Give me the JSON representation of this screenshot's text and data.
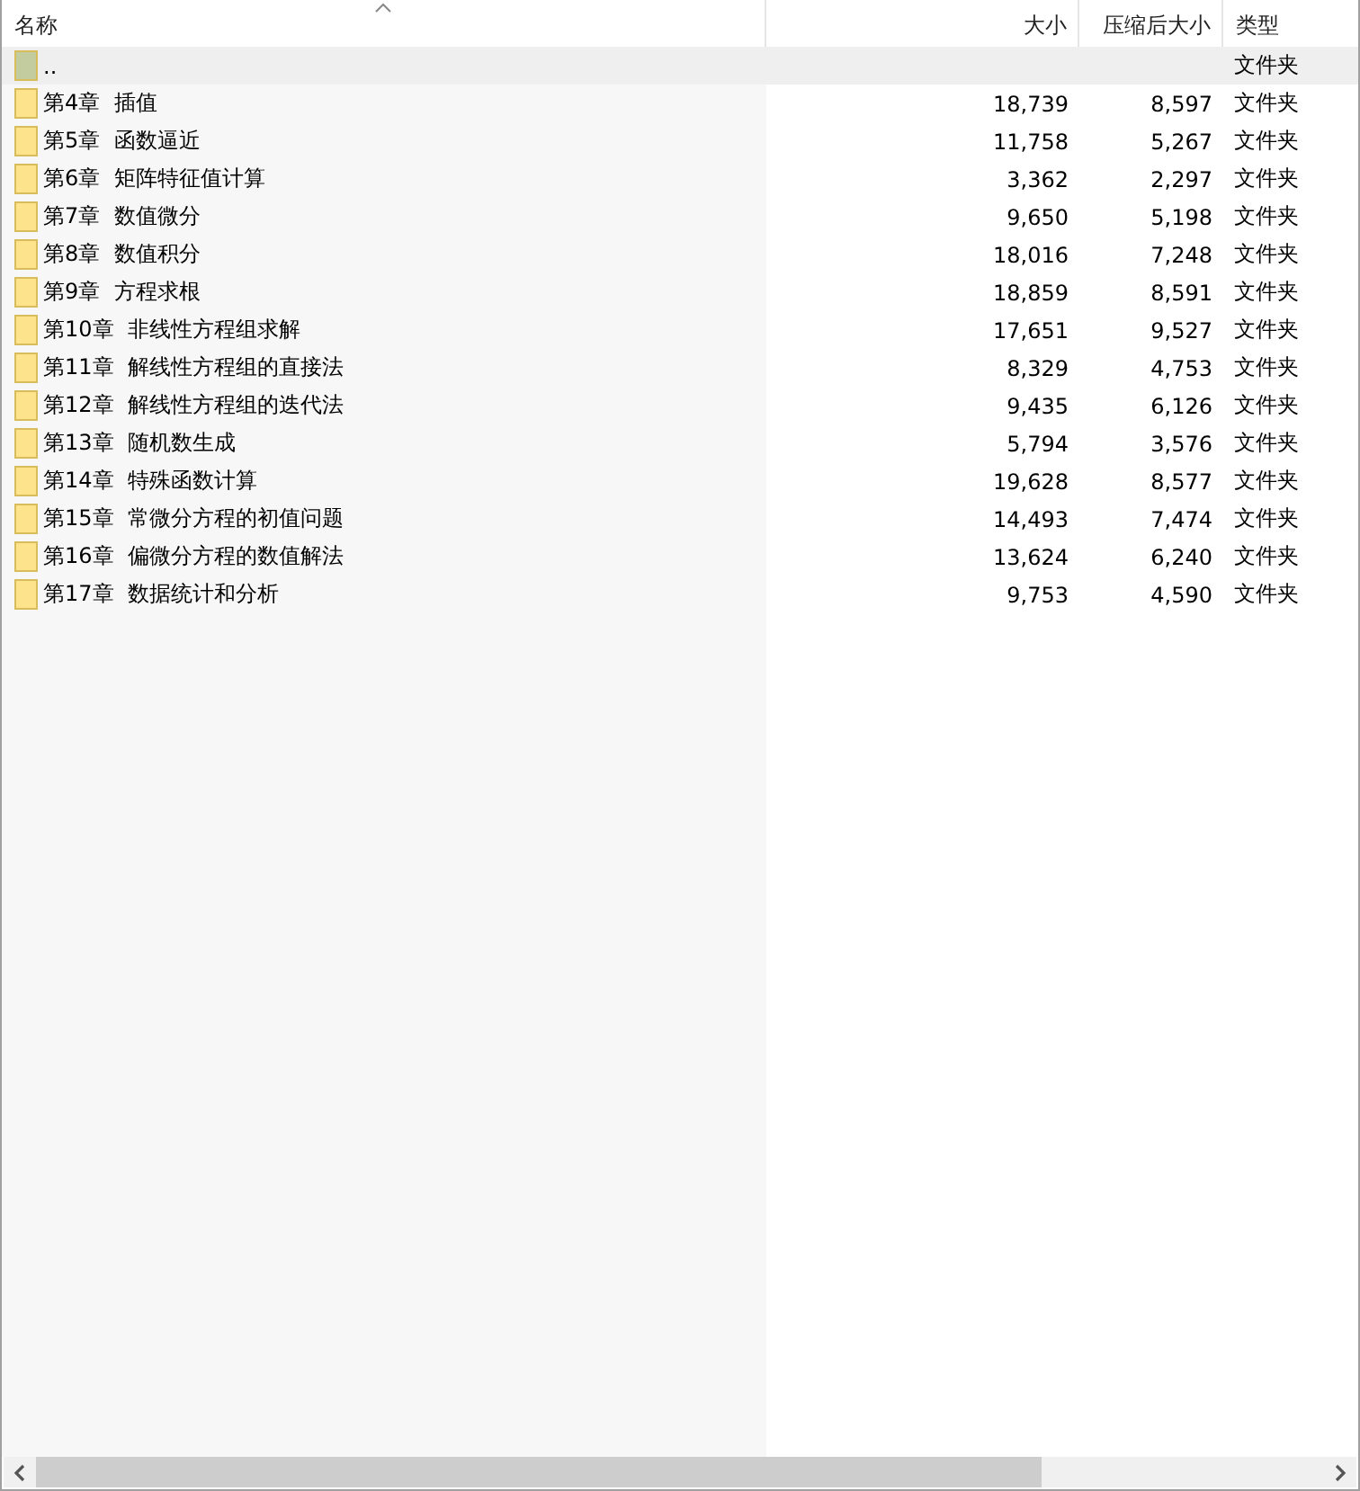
{
  "columns": [
    {
      "label": "名称",
      "sorted": true
    },
    {
      "label": "大小",
      "sorted": false
    },
    {
      "label": "压缩后大小",
      "sorted": false
    },
    {
      "label": "类型",
      "sorted": false
    }
  ],
  "rows": [
    {
      "kind": "parent",
      "name": "..",
      "size": "",
      "packed": "",
      "type": "文件夹",
      "selected": true
    },
    {
      "kind": "folder",
      "name": "第4章  插值",
      "size": "18,739",
      "packed": "8,597",
      "type": "文件夹",
      "selected": false
    },
    {
      "kind": "folder",
      "name": "第5章  函数逼近",
      "size": "11,758",
      "packed": "5,267",
      "type": "文件夹",
      "selected": false
    },
    {
      "kind": "folder",
      "name": "第6章  矩阵特征值计算",
      "size": "3,362",
      "packed": "2,297",
      "type": "文件夹",
      "selected": false
    },
    {
      "kind": "folder",
      "name": "第7章  数值微分",
      "size": "9,650",
      "packed": "5,198",
      "type": "文件夹",
      "selected": false
    },
    {
      "kind": "folder",
      "name": "第8章  数值积分",
      "size": "18,016",
      "packed": "7,248",
      "type": "文件夹",
      "selected": false
    },
    {
      "kind": "folder",
      "name": "第9章  方程求根",
      "size": "18,859",
      "packed": "8,591",
      "type": "文件夹",
      "selected": false
    },
    {
      "kind": "folder",
      "name": "第10章  非线性方程组求解",
      "size": "17,651",
      "packed": "9,527",
      "type": "文件夹",
      "selected": false
    },
    {
      "kind": "folder",
      "name": "第11章  解线性方程组的直接法",
      "size": "8,329",
      "packed": "4,753",
      "type": "文件夹",
      "selected": false
    },
    {
      "kind": "folder",
      "name": "第12章  解线性方程组的迭代法",
      "size": "9,435",
      "packed": "6,126",
      "type": "文件夹",
      "selected": false
    },
    {
      "kind": "folder",
      "name": "第13章  随机数生成",
      "size": "5,794",
      "packed": "3,576",
      "type": "文件夹",
      "selected": false
    },
    {
      "kind": "folder",
      "name": "第14章  特殊函数计算",
      "size": "19,628",
      "packed": "8,577",
      "type": "文件夹",
      "selected": false
    },
    {
      "kind": "folder",
      "name": "第15章  常微分方程的初值问题",
      "size": "14,493",
      "packed": "7,474",
      "type": "文件夹",
      "selected": false
    },
    {
      "kind": "folder",
      "name": "第16章  偏微分方程的数值解法",
      "size": "13,624",
      "packed": "6,240",
      "type": "文件夹",
      "selected": false
    },
    {
      "kind": "folder",
      "name": "第17章  数据统计和分析",
      "size": "9,753",
      "packed": "4,590",
      "type": "文件夹",
      "selected": false
    }
  ]
}
